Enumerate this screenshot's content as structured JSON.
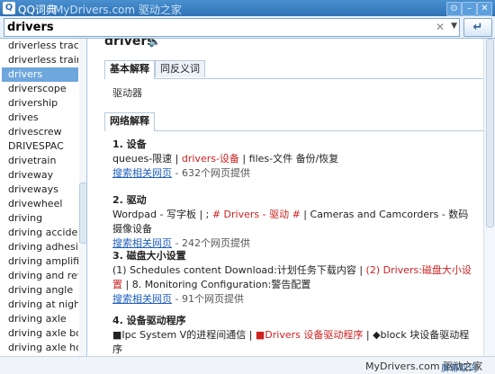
{
  "window": {
    "title": "QQ词典",
    "watermark": "MyDrivers.com 驱动之家",
    "buttons": {
      "pin": "⊙",
      "minimize": "–",
      "close": "✕"
    }
  },
  "search": {
    "value": "drivers",
    "clear_icon": "✕",
    "dropdown_icon": "▼",
    "go_label": "↵"
  },
  "word_list": [
    "driverless tractor",
    "driverless train",
    "drivers",
    "driverscope",
    "drivership",
    "drives",
    "drivescrew",
    "DRIVESPAC",
    "drivetrain",
    "driveway",
    "driveways",
    "drivewheel",
    "driving",
    "driving accident",
    "driving adhesion co",
    "driving amplifier",
    "driving and reversin",
    "driving angle",
    "driving at night",
    "driving axle",
    "driving axle box",
    "driving axle housing"
  ],
  "selected_index": 2,
  "entry": {
    "headword": "drivers",
    "tabs": [
      "基本解释",
      "同反义词"
    ],
    "basic_definition": "驱动器",
    "net_tab": "网络解释",
    "net": [
      {
        "title": "1. 设备",
        "parts": [
          {
            "t": "queues-限速 | ",
            "c": "n"
          },
          {
            "t": "drivers-设备",
            "c": "r"
          },
          {
            "t": " | files-文件 备份/恢复",
            "c": "n"
          }
        ],
        "link": "搜索相关网页",
        "count": " - 632个网页提供"
      },
      {
        "title": "2. 驱动",
        "parts": [
          {
            "t": "Wordpad - 写字板 | ; ",
            "c": "n"
          },
          {
            "t": "# Drivers - 驱动 #",
            "c": "r"
          },
          {
            "t": " | Cameras and Camcorders - 数码摄像设备",
            "c": "n"
          }
        ],
        "link": "搜索相关网页",
        "count": " - 242个网页提供"
      },
      {
        "title": "3. 磁盘大小设置",
        "parts": [
          {
            "t": "(1) Schedules content Download:计划任务下载内容 | ",
            "c": "n"
          },
          {
            "t": "(2) Drivers:磁盘大小设置",
            "c": "r"
          },
          {
            "t": " | 8. Monitoring Configuration:警告配置",
            "c": "n"
          }
        ],
        "link": "搜索相关网页",
        "count": " - 91个网页提供"
      },
      {
        "title": "4. 设备驱动程序",
        "parts": [
          {
            "t": "■Ipc System V的进程间通信 | ",
            "c": "n"
          },
          {
            "t": "■Drivers 设备驱动程序",
            "c": "r"
          },
          {
            "t": " | ◆block 块设备驱动程序",
            "c": "n"
          }
        ],
        "link": "搜索相关网页",
        "count": " - 87个网页提供"
      }
    ]
  },
  "status": {
    "watermark": "MyDrivers.com 驱动之家",
    "button": "屏幕取词"
  }
}
